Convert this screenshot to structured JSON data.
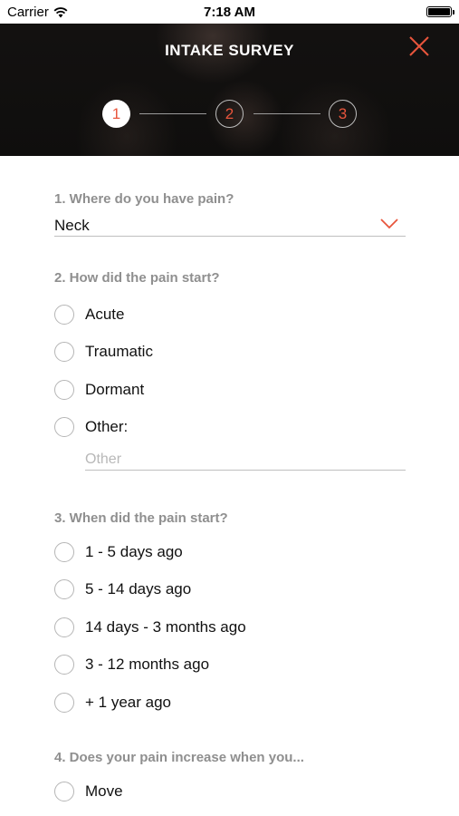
{
  "status_bar": {
    "carrier": "Carrier",
    "time": "7:18 AM"
  },
  "header": {
    "title": "INTAKE SURVEY",
    "close_icon": "close-icon",
    "accent_color": "#e8553c",
    "steps": [
      "1",
      "2",
      "3"
    ],
    "active_step": 1
  },
  "questions": {
    "q1": {
      "label": "1. Where do you have pain?",
      "selected": "Neck"
    },
    "q2": {
      "label": "2. How did the pain start?",
      "options": [
        "Acute",
        "Traumatic",
        "Dormant",
        "Other:"
      ],
      "other_placeholder": "Other"
    },
    "q3": {
      "label": "3. When did the pain start?",
      "options": [
        "1 - 5 days ago",
        "5 - 14 days ago",
        "14 days - 3 months ago",
        "3 - 12 months ago",
        "+ 1 year ago"
      ]
    },
    "q4": {
      "label": "4. Does your pain increase when you...",
      "options": [
        "Move"
      ]
    }
  }
}
